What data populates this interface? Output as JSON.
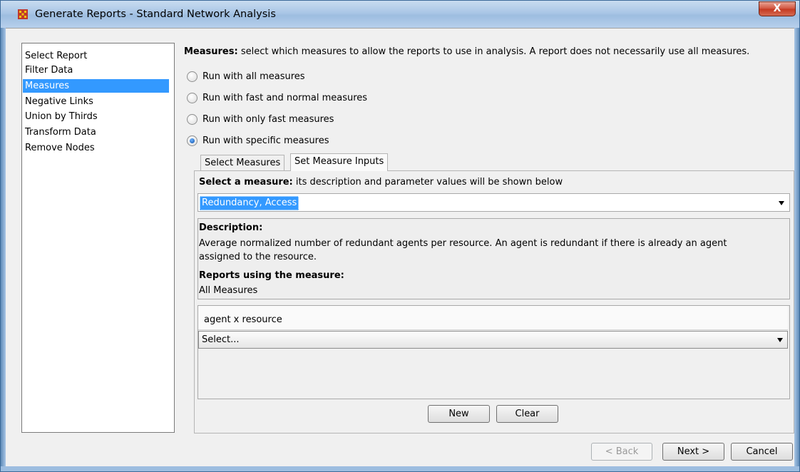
{
  "window": {
    "title": "Generate Reports - Standard Network Analysis",
    "close_glyph": "X"
  },
  "nav": {
    "items": [
      {
        "label": "Select Report",
        "selected": false
      },
      {
        "label": "Filter Data",
        "selected": false
      },
      {
        "label": "Measures",
        "selected": true
      },
      {
        "label": "Negative Links",
        "selected": false
      },
      {
        "label": "Union by Thirds",
        "selected": false
      },
      {
        "label": "Transform Data",
        "selected": false
      },
      {
        "label": "Remove Nodes",
        "selected": false
      }
    ]
  },
  "measures": {
    "header_bold": "Measures:",
    "header_text": " select which measures to allow the reports to use in analysis. A report does not necessarily use all measures.",
    "options": [
      {
        "label": "Run with all measures",
        "checked": false
      },
      {
        "label": "Run with fast and normal measures",
        "checked": false
      },
      {
        "label": "Run with only fast measures",
        "checked": false
      },
      {
        "label": "Run with specific measures",
        "checked": true
      }
    ]
  },
  "tabs": [
    {
      "label": "Select Measures",
      "active": false
    },
    {
      "label": "Set Measure Inputs",
      "active": true
    }
  ],
  "panel": {
    "select_label_bold": "Select a measure:",
    "select_label_text": " its description and parameter values will be shown below",
    "selected_measure": "Redundancy, Access",
    "description_title": "Description:",
    "description_text": "Average normalized number of redundant agents per resource. An agent is redundant if there is already an agent assigned to the resource.",
    "reports_title": "Reports using the measure:",
    "reports_text": "All Measures",
    "param_label": "agent x resource",
    "param_select": "Select...",
    "new_label": "New",
    "clear_label": "Clear"
  },
  "footer": {
    "back_label": "< Back",
    "next_label": "Next >",
    "cancel_label": "Cancel"
  },
  "colors": {
    "selection": "#3399ff",
    "titlebar": "#a9c6e6",
    "close": "#c4381f"
  }
}
